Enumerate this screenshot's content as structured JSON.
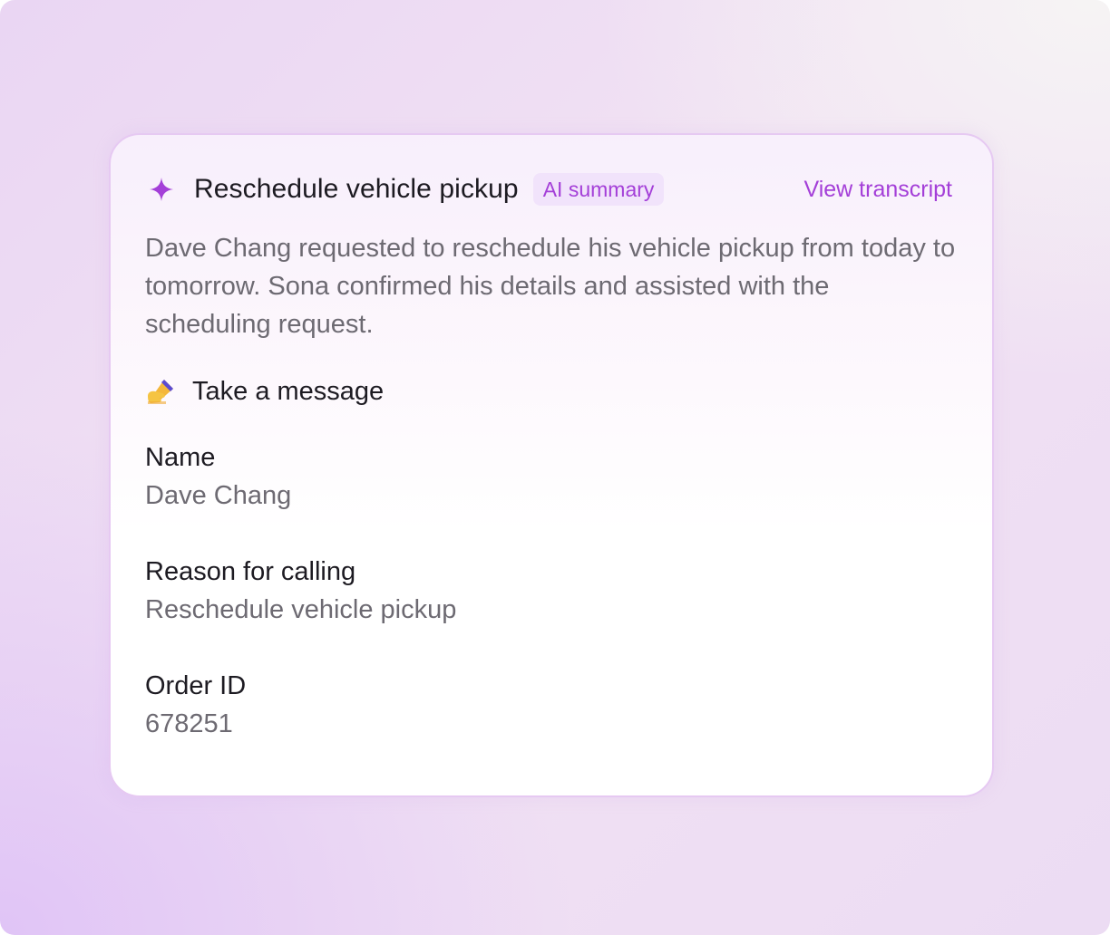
{
  "card": {
    "title": "Reschedule vehicle pickup",
    "badge": "AI summary",
    "link": "View transcript",
    "summary": "Dave Chang requested to reschedule his vehicle pickup from today to tomorrow. Sona confirmed his details and assisted with the scheduling request.",
    "section_icon": "writing-hand-icon",
    "title_icon": "sparkle-icon",
    "section_title": "Take a message",
    "fields": [
      {
        "label": "Name",
        "value": "Dave Chang"
      },
      {
        "label": "Reason for calling",
        "value": "Reschedule vehicle pickup"
      },
      {
        "label": "Order ID",
        "value": "678251"
      }
    ]
  },
  "colors": {
    "accent": "#a43fd8",
    "badge_bg": "#f1e3fb",
    "text_primary": "#1d1b22",
    "text_secondary": "#6d6a72",
    "card_border": "#e6c9f2"
  }
}
